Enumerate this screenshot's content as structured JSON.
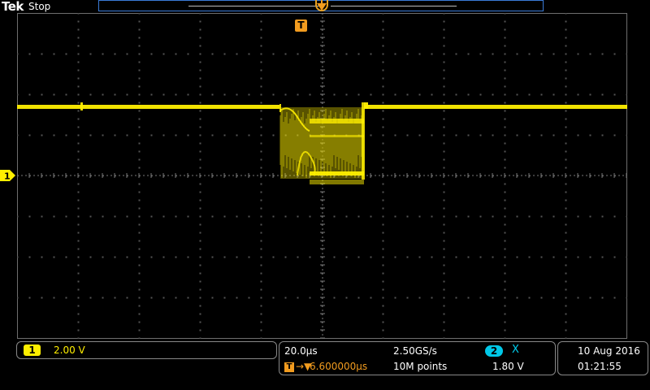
{
  "header": {
    "brand": "Tek",
    "run_state": "Stop"
  },
  "trigger": {
    "marker_glyph": "T",
    "color": "#f29c1f"
  },
  "channel1": {
    "badge": "1",
    "scale": "2.00 V",
    "color": "#ffef00"
  },
  "horizontal": {
    "time_per_div": "20.0µs",
    "sample_rate": "2.50GS/s",
    "record_length": "10M points",
    "trigger_position_icon": "T",
    "trigger_delay_arrow": "→▼",
    "trigger_delay": "6.600000µs"
  },
  "trigger_settings": {
    "source_badge": "2",
    "source_color": "#00c8e8",
    "slope": "X",
    "level": "1.80 V"
  },
  "datetime": {
    "date": "10 Aug 2016",
    "time": "01:21:55"
  },
  "icons": {
    "trigger_marker": "trigger-T-icon",
    "channel_ground_marker": "channel-1-ground-icon"
  }
}
